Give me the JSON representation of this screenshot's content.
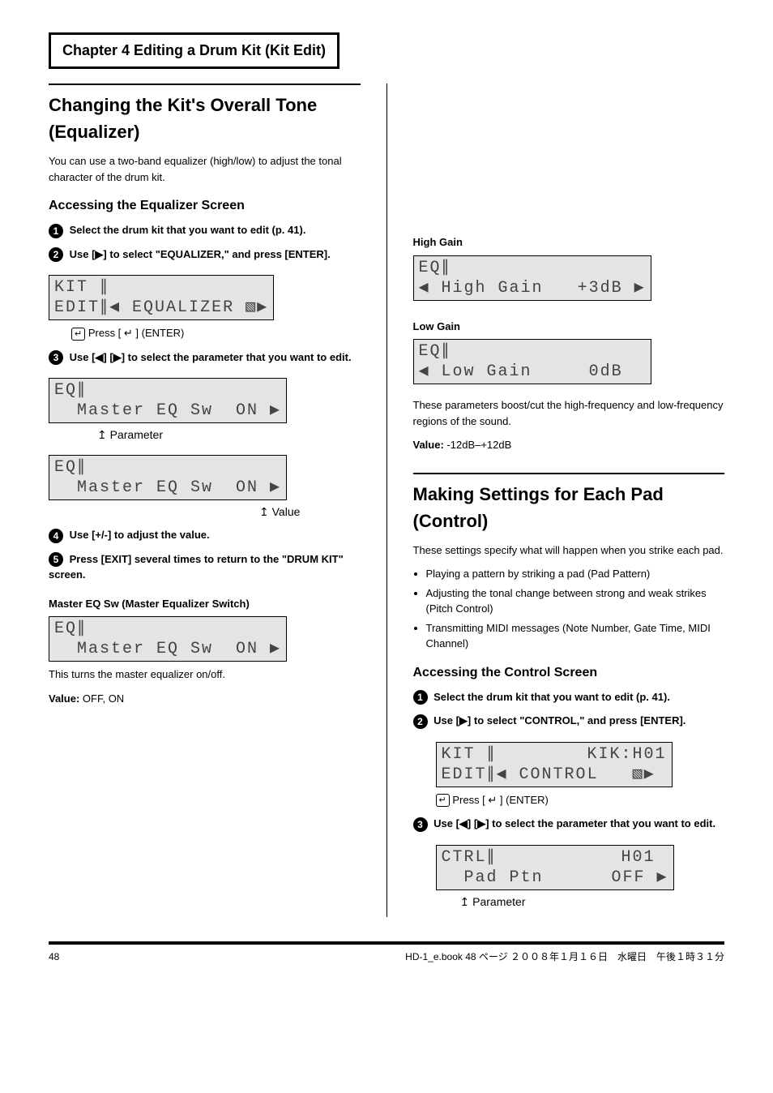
{
  "header": "Chapter 4  Editing a Drum Kit (Kit Edit)",
  "left": {
    "title": "Changing the Kit's Overall Tone (Equalizer)",
    "intro": "You can use a two-band equalizer (high/low) to adjust the tonal character of the drum kit.",
    "func_heading": "Accessing the Equalizer Screen",
    "step1_a": "Select the drum kit that you want to edit (p. 41).",
    "step1_b_pre": "Use [",
    "step1_b_post": "] to select \"EQUALIZER,\" and press [ENTER].",
    "lcd1_l1": "KIT ∥",
    "lcd1_l2": "EDIT∥◀ EQUALIZER ▧▶",
    "enter_note": "Press [ ↵ ] (ENTER)",
    "step2_pre": "Use [",
    "step2_mid": "] [",
    "step2_post": "] to select the parameter that you want to edit.",
    "lcd2_l1": "EQ∥",
    "lcd2_l2": "  Master EQ Sw  ON ▶",
    "arrow_label_param": "↥ Parameter",
    "lcd3_l1": "EQ∥",
    "lcd3_l2": "  Master EQ Sw  ON ▶",
    "arrow_label_value": "↥ Value",
    "step3": "Use [+/-] to adjust the value.",
    "step4": "Press [EXIT] several times to return to the \"DRUM KIT\" screen.",
    "param1_name": "Master EQ Sw (Master Equalizer Switch)",
    "param1_lcd_l1": "EQ∥",
    "param1_lcd_l2": "  Master EQ Sw  ON ▶",
    "param1_desc": "This turns the master equalizer on/off.",
    "param1_value_label": "Value: ",
    "param1_value": "OFF, ON"
  },
  "right": {
    "param2_name": "High Gain",
    "param2_lcd_l1": "EQ∥",
    "param2_lcd_l2": "◀ High Gain   +3dB ▶",
    "param3_name": "Low Gain",
    "param3_lcd_l1": "EQ∥",
    "param3_lcd_l2": "◀ Low Gain     0dB  ",
    "gain_desc": "These parameters boost/cut the high-frequency and low-frequency regions of the sound.",
    "gain_value_label": "Value: ",
    "gain_value": "-12dB–+12dB",
    "title2": "Making Settings for Each Pad (Control)",
    "intro2": "These settings specify what will happen when you strike each pad.",
    "func_heading2": "Accessing the Control Screen",
    "bullet1": "Playing a pattern by striking a pad (Pad Pattern)",
    "bullet2": "Adjusting the tonal change between strong and weak strikes (Pitch Control)",
    "bullet3": "Transmitting MIDI messages (Note Number, Gate Time, MIDI Channel)",
    "step1b": "Select the drum kit that you want to edit (p. 41).",
    "step2b_pre": "Use [",
    "step2b_post": "] to select \"CONTROL,\" and press [ENTER].",
    "lcd4_l1": "KIT ∥        KIK:H01",
    "lcd4_l2": "EDIT∥◀ CONTROL   ▧▶",
    "enter_note2": "Press [ ↵ ] (ENTER)",
    "step3b_pre": "Use [",
    "step3b_mid": "] [",
    "step3b_post": "] to select the parameter that you want to edit.",
    "lcd5_l1": "CTRL∥           H01",
    "lcd5_l2": "  Pad Ptn      OFF ▶",
    "arrow_label_param2": "↥ Parameter"
  },
  "footer": {
    "page": "48",
    "doc": "HD-1_e.book  48 ページ  ２００８年１月１６日　水曜日　午後１時３１分"
  }
}
